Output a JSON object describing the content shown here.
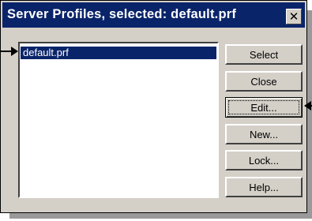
{
  "dialog": {
    "title": "Server Profiles, selected: default.prf",
    "close_glyph": "✕"
  },
  "profiles": {
    "items": [
      "default.prf"
    ],
    "selected": "default.prf"
  },
  "buttons": {
    "select": "Select",
    "close": "Close",
    "edit": "Edit...",
    "new": "New...",
    "lock": "Lock...",
    "help": "Help..."
  },
  "colors": {
    "titlebar": "#0a246a",
    "selection": "#0a246a",
    "face": "#d4d0c8"
  },
  "icons": {
    "close": "close-icon",
    "left_pointer": "arrow-right-icon",
    "right_pointer": "arrow-left-icon"
  }
}
